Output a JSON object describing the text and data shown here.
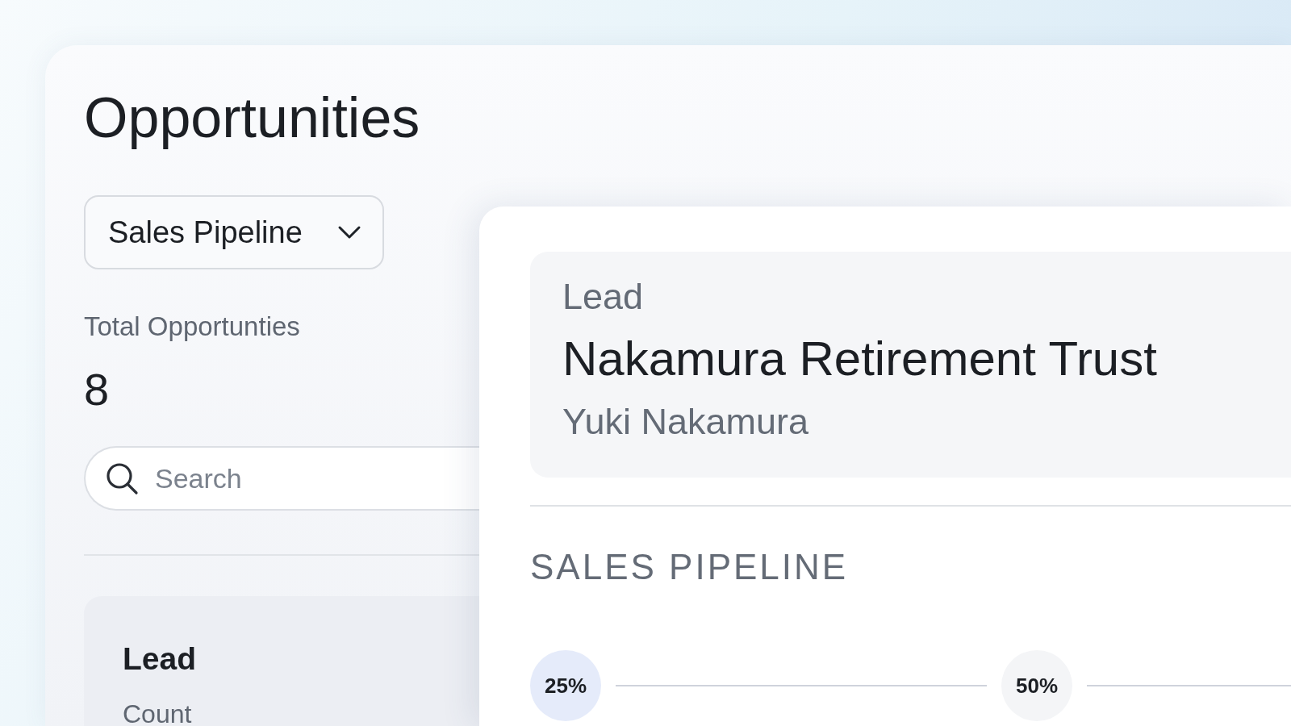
{
  "page": {
    "title": "Opportunities"
  },
  "pipeline_select": {
    "value": "Sales Pipeline"
  },
  "summary": {
    "label": "Total Opportunties",
    "value": "8"
  },
  "search": {
    "placeholder": "Search"
  },
  "stage_card": {
    "title": "Lead",
    "label": "Count"
  },
  "detail": {
    "stage": "Lead",
    "name": "Nakamura Retirement Trust",
    "contact": "Yuki Nakamura",
    "section_title": "SALES PIPELINE",
    "steps": [
      {
        "label": "25%",
        "selected": true
      },
      {
        "label": "50%",
        "selected": false
      }
    ]
  }
}
